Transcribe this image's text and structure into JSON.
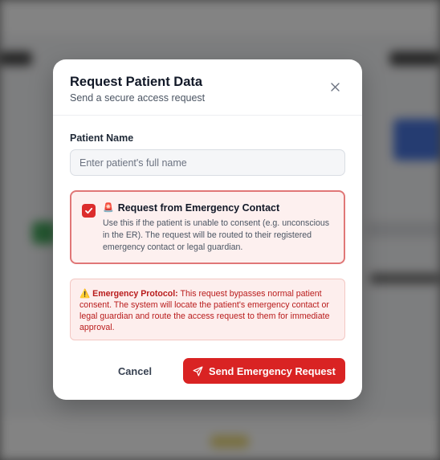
{
  "modal": {
    "title": "Request Patient Data",
    "subtitle": "Send a secure access request"
  },
  "patient_name": {
    "label": "Patient Name",
    "value": "",
    "placeholder": "Enter patient's full name"
  },
  "emergency_option": {
    "checked": true,
    "icon": "🚨",
    "title": "Request from Emergency Contact",
    "description": "Use this if the patient is unable to consent (e.g. unconscious in the ER). The request will be routed to their registered emergency contact or legal guardian."
  },
  "protocol_notice": {
    "icon": "⚠️",
    "heading": "Emergency Protocol:",
    "text": "This request bypasses normal patient consent. The system will locate the patient's emergency contact or legal guardian and route the access request to them for immediate approval."
  },
  "footer": {
    "cancel_label": "Cancel",
    "send_label": "Send Emergency Request"
  },
  "colors": {
    "accent": "#d92323",
    "card_border": "#e07777",
    "card_bg": "#fdf0ef",
    "warning_text": "#b91c1c"
  }
}
